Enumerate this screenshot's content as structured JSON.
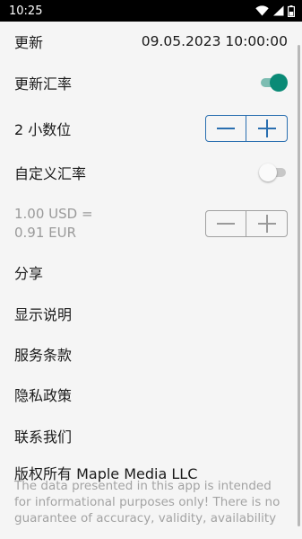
{
  "status_bar": {
    "time": "10:25"
  },
  "settings": {
    "update": {
      "label": "更新",
      "value": "09.05.2023 10:00:00"
    },
    "update_rates": {
      "label": "更新汇率",
      "toggle_on": true
    },
    "decimals": {
      "label": "2 小数位"
    },
    "custom_rate": {
      "label": "自定义汇率",
      "toggle_on": false
    },
    "custom_rate_value": {
      "line1": "1.00 USD =",
      "line2": "0.91 EUR"
    }
  },
  "menu": {
    "share": "分享",
    "show_instructions": "显示说明",
    "terms": "服务条款",
    "privacy": "隐私政策",
    "contact": "联系我们",
    "copyright": "版权所有 Maple Media LLC"
  },
  "disclaimer": "The data presented in this app is intended for informational purposes only! There is no guarantee of accuracy, validity, availability",
  "colors": {
    "accent": "#0a8a76",
    "stepper_blue": "#2a6fb0"
  }
}
